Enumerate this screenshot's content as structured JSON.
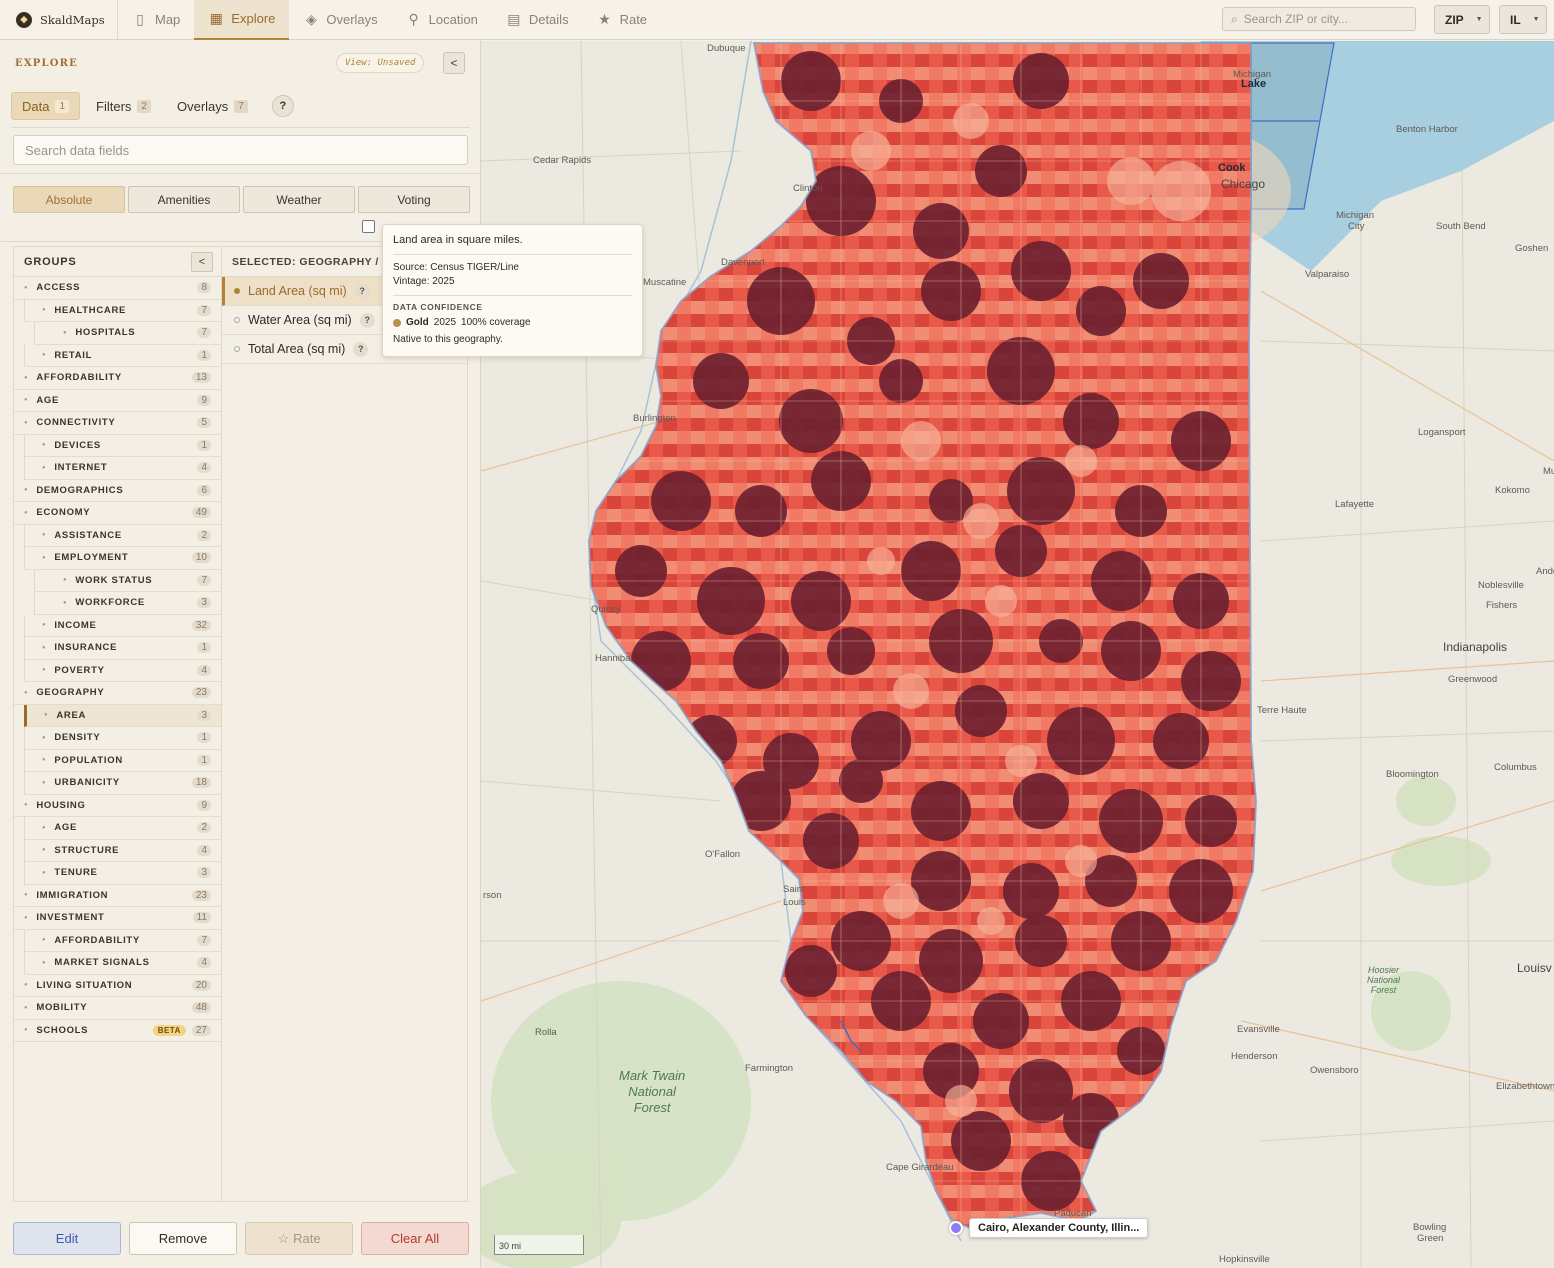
{
  "app": {
    "name": "SkaldMaps"
  },
  "nav": [
    {
      "label": "Map",
      "icon": "map-icon",
      "active": false
    },
    {
      "label": "Explore",
      "icon": "grid-icon",
      "active": true
    },
    {
      "label": "Overlays",
      "icon": "layers-icon",
      "active": false
    },
    {
      "label": "Location",
      "icon": "pin-icon",
      "active": false
    },
    {
      "label": "Details",
      "icon": "document-icon",
      "active": false
    },
    {
      "label": "Rate",
      "icon": "star-icon",
      "active": false
    }
  ],
  "top_search": {
    "placeholder": "Search ZIP or city..."
  },
  "geo_select": {
    "value": "ZIP"
  },
  "state_select": {
    "value": "IL"
  },
  "explore": {
    "title": "EXPLORE",
    "view_badge": "View: Unsaved",
    "collapse": "<"
  },
  "tabs": [
    {
      "label": "Data",
      "count": "1",
      "active": true
    },
    {
      "label": "Filters",
      "count": "2",
      "active": false
    },
    {
      "label": "Overlays",
      "count": "7",
      "active": false
    }
  ],
  "help": "?",
  "field_search": {
    "placeholder": "Search data fields"
  },
  "categories": [
    {
      "label": "Absolute",
      "active": true
    },
    {
      "label": "Amenities",
      "active": false
    },
    {
      "label": "Weather",
      "active": false
    },
    {
      "label": "Voting",
      "active": false
    }
  ],
  "groups": {
    "title": "GROUPS",
    "collapse": "<",
    "items": [
      {
        "label": "ACCESS",
        "count": "8",
        "level": 0
      },
      {
        "label": "HEALTHCARE",
        "count": "7",
        "level": 1
      },
      {
        "label": "HOSPITALS",
        "count": "7",
        "level": 2
      },
      {
        "label": "RETAIL",
        "count": "1",
        "level": 1
      },
      {
        "label": "AFFORDABILITY",
        "count": "13",
        "level": 0
      },
      {
        "label": "AGE",
        "count": "9",
        "level": 0
      },
      {
        "label": "CONNECTIVITY",
        "count": "5",
        "level": 0
      },
      {
        "label": "DEVICES",
        "count": "1",
        "level": 1
      },
      {
        "label": "INTERNET",
        "count": "4",
        "level": 1
      },
      {
        "label": "DEMOGRAPHICS",
        "count": "6",
        "level": 0
      },
      {
        "label": "ECONOMY",
        "count": "49",
        "level": 0
      },
      {
        "label": "ASSISTANCE",
        "count": "2",
        "level": 1
      },
      {
        "label": "EMPLOYMENT",
        "count": "10",
        "level": 1
      },
      {
        "label": "WORK STATUS",
        "count": "7",
        "level": 2
      },
      {
        "label": "WORKFORCE",
        "count": "3",
        "level": 2
      },
      {
        "label": "INCOME",
        "count": "32",
        "level": 1
      },
      {
        "label": "INSURANCE",
        "count": "1",
        "level": 1
      },
      {
        "label": "POVERTY",
        "count": "4",
        "level": 1
      },
      {
        "label": "GEOGRAPHY",
        "count": "23",
        "level": 0
      },
      {
        "label": "AREA",
        "count": "3",
        "level": 1,
        "selected": true
      },
      {
        "label": "DENSITY",
        "count": "1",
        "level": 1
      },
      {
        "label": "POPULATION",
        "count": "1",
        "level": 1
      },
      {
        "label": "URBANICITY",
        "count": "18",
        "level": 1
      },
      {
        "label": "HOUSING",
        "count": "9",
        "level": 0
      },
      {
        "label": "AGE",
        "count": "2",
        "level": 1
      },
      {
        "label": "STRUCTURE",
        "count": "4",
        "level": 1
      },
      {
        "label": "TENURE",
        "count": "3",
        "level": 1
      },
      {
        "label": "IMMIGRATION",
        "count": "23",
        "level": 0
      },
      {
        "label": "INVESTMENT",
        "count": "11",
        "level": 0
      },
      {
        "label": "AFFORDABILITY",
        "count": "7",
        "level": 1
      },
      {
        "label": "MARKET SIGNALS",
        "count": "4",
        "level": 1
      },
      {
        "label": "LIVING SITUATION",
        "count": "20",
        "level": 0
      },
      {
        "label": "MOBILITY",
        "count": "48",
        "level": 0
      },
      {
        "label": "SCHOOLS",
        "count": "27",
        "level": 0,
        "badge": "BETA"
      }
    ]
  },
  "fields": {
    "title": "SELECTED: GEOGRAPHY / AREA",
    "items": [
      {
        "label": "Land Area (sq mi)",
        "selected": true
      },
      {
        "label": "Water Area (sq mi)",
        "selected": false
      },
      {
        "label": "Total Area (sq mi)",
        "selected": false
      }
    ]
  },
  "tooltip": {
    "title": "Land area in square miles.",
    "source": "Source: Census TIGER/Line",
    "vintage": "Vintage: 2025",
    "confidence_heading": "DATA CONFIDENCE",
    "tier": "Gold",
    "year": "2025",
    "coverage": "100% coverage",
    "note": "Native to this geography."
  },
  "actions": {
    "edit": "Edit",
    "remove": "Remove",
    "rate": "Rate",
    "clear": "Clear All"
  },
  "map": {
    "pin_label": "Cairo, Alexander County, Illin...",
    "scale": "30 mi",
    "labels": [
      {
        "text": "Dubuque",
        "pos": [
          226,
          2
        ]
      },
      {
        "text": "Cedar Rapids",
        "pos": [
          52,
          114
        ]
      },
      {
        "text": "Clinton",
        "pos": [
          312,
          142
        ]
      },
      {
        "text": "Davenport",
        "pos": [
          240,
          216
        ]
      },
      {
        "text": "Muscatine",
        "pos": [
          162,
          236
        ]
      },
      {
        "text": "Burlington",
        "pos": [
          152,
          372
        ]
      },
      {
        "text": "Quincy",
        "pos": [
          110,
          563
        ]
      },
      {
        "text": "Hannibal",
        "pos": [
          114,
          612
        ]
      },
      {
        "text": "O'Fallon",
        "pos": [
          224,
          808
        ]
      },
      {
        "text": "Saint",
        "pos": [
          302,
          843
        ]
      },
      {
        "text": "Louis",
        "pos": [
          302,
          856
        ]
      },
      {
        "text": "Rolla",
        "pos": [
          54,
          986
        ]
      },
      {
        "text": "Farmington",
        "pos": [
          264,
          1022
        ]
      },
      {
        "text": "Cape Girardeau",
        "pos": [
          405,
          1121
        ]
      },
      {
        "text": "Paducah",
        "pos": [
          573,
          1167
        ]
      },
      {
        "text": "Hopkinsville",
        "pos": [
          738,
          1213
        ]
      },
      {
        "text": "Michigan",
        "pos": [
          855,
          169
        ]
      },
      {
        "text": "City",
        "pos": [
          867,
          180
        ]
      },
      {
        "text": "Benton Harbor",
        "pos": [
          915,
          83
        ]
      },
      {
        "text": "South Bend",
        "pos": [
          955,
          180
        ]
      },
      {
        "text": "Goshen",
        "pos": [
          1034,
          202
        ]
      },
      {
        "text": "Valparaiso",
        "pos": [
          824,
          228
        ]
      },
      {
        "text": "Logansport",
        "pos": [
          937,
          386
        ]
      },
      {
        "text": "Kokomo",
        "pos": [
          1014,
          444
        ]
      },
      {
        "text": "Lafayette",
        "pos": [
          854,
          458
        ]
      },
      {
        "text": "Noblesville",
        "pos": [
          997,
          539
        ]
      },
      {
        "text": "Fishers",
        "pos": [
          1005,
          559
        ]
      },
      {
        "text": "Indianapolis",
        "pos": [
          962,
          599
        ],
        "big": true
      },
      {
        "text": "Greenwood",
        "pos": [
          967,
          633
        ]
      },
      {
        "text": "Terre Haute",
        "pos": [
          776,
          664
        ]
      },
      {
        "text": "Bloomington",
        "pos": [
          905,
          728
        ]
      },
      {
        "text": "Columbus",
        "pos": [
          1013,
          721
        ]
      },
      {
        "text": "Evansville",
        "pos": [
          756,
          983
        ]
      },
      {
        "text": "Henderson",
        "pos": [
          750,
          1010
        ]
      },
      {
        "text": "Owensboro",
        "pos": [
          829,
          1024
        ]
      },
      {
        "text": "Elizabethtown",
        "pos": [
          1015,
          1040
        ]
      },
      {
        "text": "Bowling",
        "pos": [
          932,
          1181
        ]
      },
      {
        "text": "Green",
        "pos": [
          936,
          1192
        ]
      },
      {
        "text": "Louisv",
        "pos": [
          1036,
          920
        ],
        "big": true
      },
      {
        "text": "Michigan",
        "pos": [
          752,
          28
        ]
      },
      {
        "text": "Chicago",
        "pos": [
          740,
          136
        ],
        "big": true
      },
      {
        "text": "Anders",
        "pos": [
          1055,
          525
        ]
      },
      {
        "text": "Mu",
        "pos": [
          1062,
          425
        ]
      },
      {
        "text": "rson",
        "pos": [
          2,
          849
        ]
      }
    ],
    "forest": [
      "Mark Twain",
      "National",
      "Forest"
    ],
    "hoosier": [
      "Hoosier",
      "National",
      "Forest"
    ],
    "lake": "Lake",
    "cook": "Cook"
  }
}
